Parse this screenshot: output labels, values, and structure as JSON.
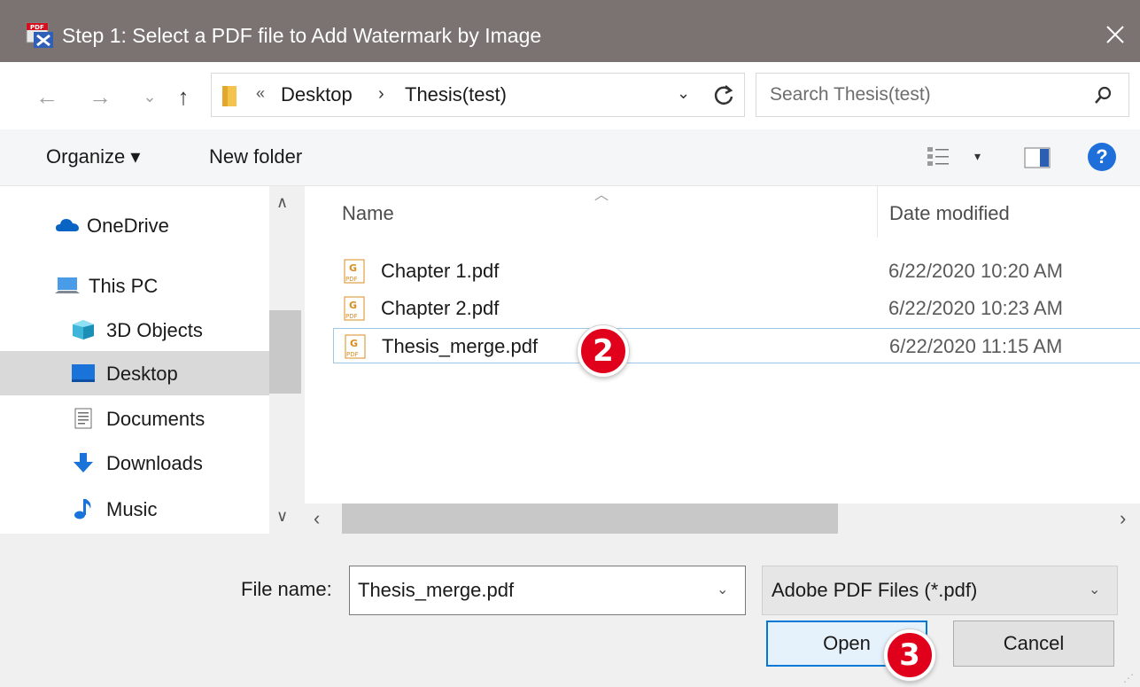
{
  "window": {
    "title": "Step 1: Select a PDF file to Add Watermark by Image",
    "close_glyph": "✕",
    "app_icon": "pdf-tool-icon"
  },
  "address": {
    "back_glyph": "←",
    "forward_glyph": "→",
    "recent_glyph": "⌄",
    "up_glyph": "↑",
    "chevron_glyph": "«",
    "crumbs": [
      "Desktop",
      "Thesis(test)"
    ],
    "sep_glyph": "›",
    "dropdown_glyph": "⌄",
    "search_placeholder": "Search Thesis(test)"
  },
  "toolbar": {
    "organize_label": "Organize ▾",
    "new_folder_label": "New folder",
    "view_dropdown_glyph": "▾",
    "help_label": "?"
  },
  "nav": {
    "up_glyph": "∧",
    "down_glyph": "∨",
    "items": [
      {
        "label": "OneDrive",
        "icon": "cloud-icon"
      },
      {
        "label": "This PC",
        "icon": "computer-icon"
      },
      {
        "label": "3D Objects",
        "icon": "cube-icon"
      },
      {
        "label": "Desktop",
        "icon": "desktop-icon",
        "selected": true
      },
      {
        "label": "Documents",
        "icon": "document-icon"
      },
      {
        "label": "Downloads",
        "icon": "download-arrow-icon"
      },
      {
        "label": "Music",
        "icon": "music-note-icon"
      }
    ]
  },
  "files": {
    "columns": [
      "Name",
      "Date modified"
    ],
    "sort_glyph": "︿",
    "rows": [
      {
        "name": "Chapter 1.pdf",
        "date": "6/22/2020 10:20 AM"
      },
      {
        "name": "Chapter 2.pdf",
        "date": "6/22/2020 10:23 AM"
      },
      {
        "name": "Thesis_merge.pdf",
        "date": "6/22/2020 11:15 AM",
        "selected": true
      }
    ],
    "scroll_left_glyph": "‹",
    "scroll_right_glyph": "›"
  },
  "badges": {
    "step2": "2",
    "step3": "3"
  },
  "footer": {
    "file_name_label": "File name:",
    "file_name_value": "Thesis_merge.pdf",
    "filter_label": "Adobe PDF Files (*.pdf)",
    "dropdown_glyph": "⌄",
    "open_label": "Open",
    "cancel_label": "Cancel"
  },
  "colors": {
    "titlebar": "#7a7372",
    "selection": "#d9d9d9",
    "accent": "#0078d7",
    "badge": "#e0001b"
  }
}
